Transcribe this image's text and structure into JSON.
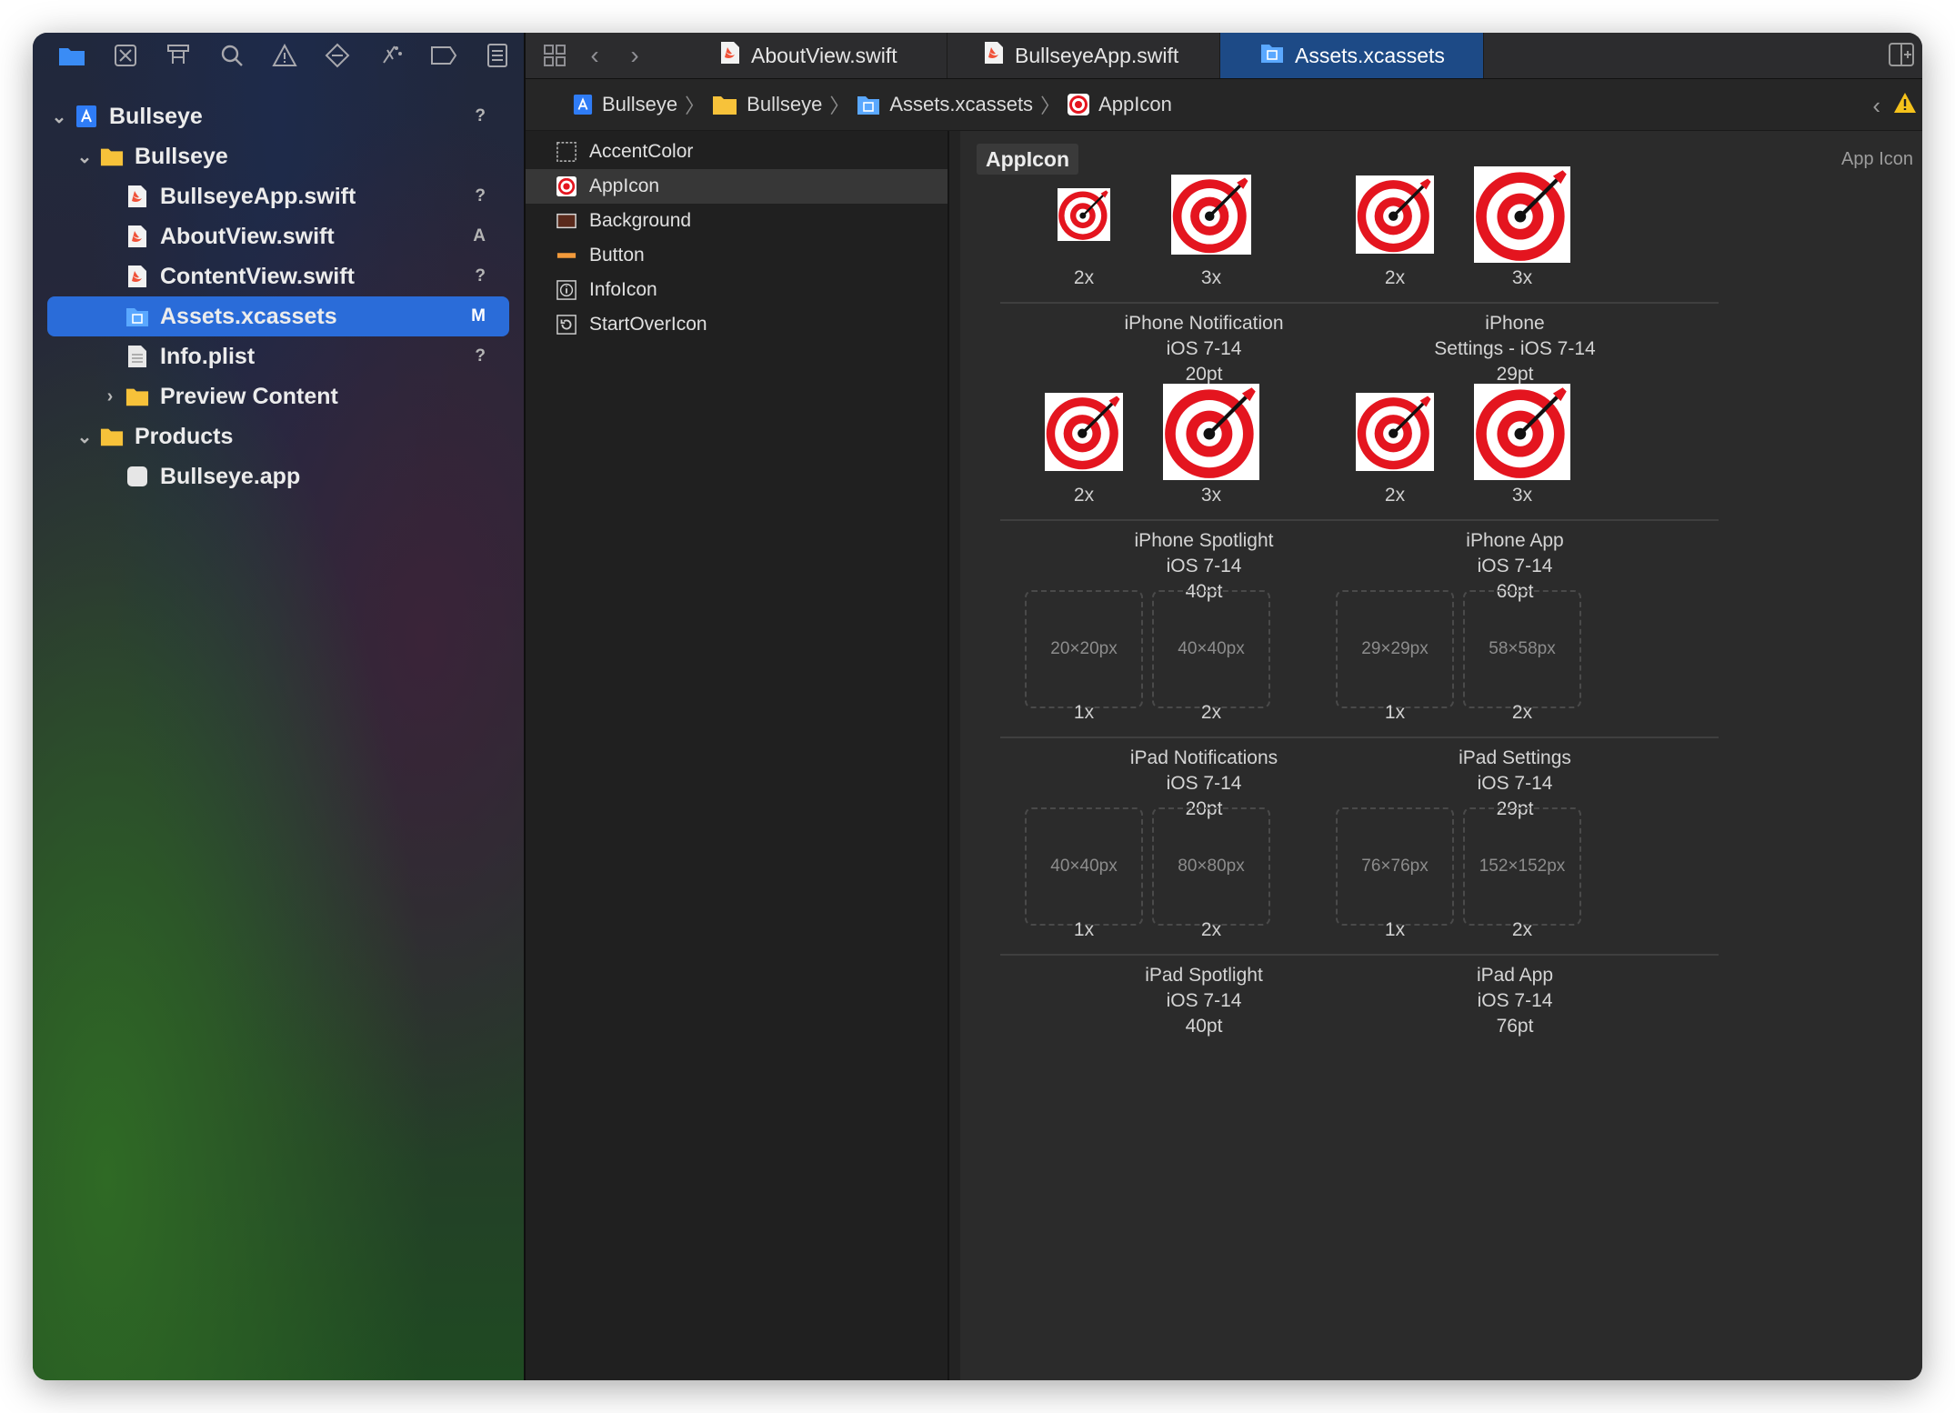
{
  "tabs": [
    {
      "label": "AboutView.swift",
      "icon": "swift-file-icon"
    },
    {
      "label": "BullseyeApp.swift",
      "icon": "swift-file-icon"
    },
    {
      "label": "Assets.xcassets",
      "icon": "asset-catalog-icon"
    }
  ],
  "breadcrumb": [
    "Bullseye",
    "Bullseye",
    "Assets.xcassets",
    "AppIcon"
  ],
  "navigator": [
    {
      "label": "Bullseye",
      "status": "?",
      "icon": "project-icon"
    },
    {
      "label": "Bullseye",
      "status": "",
      "icon": "folder-icon"
    },
    {
      "label": "BullseyeApp.swift",
      "status": "?",
      "icon": "swift-file-icon"
    },
    {
      "label": "AboutView.swift",
      "status": "A",
      "icon": "swift-file-icon"
    },
    {
      "label": "ContentView.swift",
      "status": "?",
      "icon": "swift-file-icon"
    },
    {
      "label": "Assets.xcassets",
      "status": "M",
      "icon": "asset-catalog-icon"
    },
    {
      "label": "Info.plist",
      "status": "?",
      "icon": "plist-icon"
    },
    {
      "label": "Preview Content",
      "status": "",
      "icon": "folder-icon"
    },
    {
      "label": "Products",
      "status": "",
      "icon": "folder-icon"
    },
    {
      "label": "Bullseye.app",
      "status": "",
      "icon": "app-icon"
    }
  ],
  "assets": [
    "AccentColor",
    "AppIcon",
    "Background",
    "Button",
    "InfoIcon",
    "StartOverIcon"
  ],
  "content": {
    "title": "AppIcon",
    "kind": "App Icon",
    "groups": [
      {
        "l1": "iPhone Notification",
        "l2": "iOS 7-14",
        "l3": "20pt",
        "slots": [
          {
            "scale": "2x",
            "size": ""
          },
          {
            "scale": "3x",
            "size": ""
          }
        ]
      },
      {
        "l1": "iPhone",
        "l2": "Settings - iOS 7-14",
        "l3": "29pt",
        "slots": [
          {
            "scale": "2x",
            "size": ""
          },
          {
            "scale": "3x",
            "size": ""
          }
        ]
      },
      {
        "l1": "iPhone Spotlight",
        "l2": "iOS 7-14",
        "l3": "40pt",
        "slots": [
          {
            "scale": "2x",
            "size": ""
          },
          {
            "scale": "3x",
            "size": ""
          }
        ]
      },
      {
        "l1": "iPhone App",
        "l2": "iOS 7-14",
        "l3": "60pt",
        "slots": [
          {
            "scale": "2x",
            "size": ""
          },
          {
            "scale": "3x",
            "size": ""
          }
        ]
      },
      {
        "l1": "iPad Notifications",
        "l2": "iOS 7-14",
        "l3": "20pt",
        "slots": [
          {
            "scale": "1x",
            "size": "20×20px"
          },
          {
            "scale": "2x",
            "size": "40×40px"
          }
        ]
      },
      {
        "l1": "iPad Settings",
        "l2": "iOS 7-14",
        "l3": "29pt",
        "slots": [
          {
            "scale": "1x",
            "size": "29×29px"
          },
          {
            "scale": "2x",
            "size": "58×58px"
          }
        ]
      },
      {
        "l1": "iPad Spotlight",
        "l2": "iOS 7-14",
        "l3": "40pt",
        "slots": [
          {
            "scale": "1x",
            "size": "40×40px"
          },
          {
            "scale": "2x",
            "size": "80×80px"
          }
        ]
      },
      {
        "l1": "iPad App",
        "l2": "iOS 7-14",
        "l3": "76pt",
        "slots": [
          {
            "scale": "1x",
            "size": "76×76px"
          },
          {
            "scale": "2x",
            "size": "152×152px"
          }
        ]
      }
    ]
  },
  "colors": {
    "accent": "#2a6cd9",
    "target_red": "#e4151f",
    "active_tab": "#1d4a86"
  }
}
